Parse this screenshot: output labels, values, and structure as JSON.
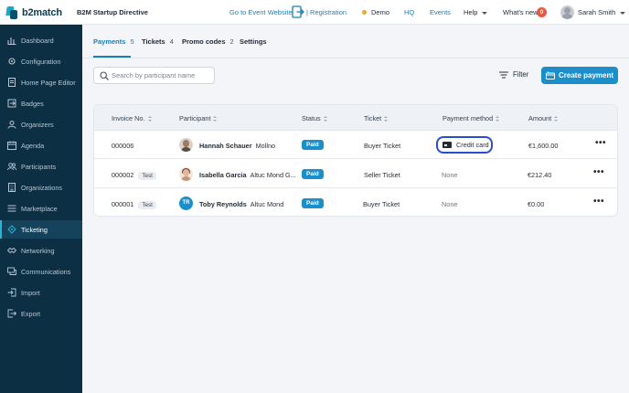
{
  "header": {
    "logo_text": "b2match",
    "event_title": "B2M Startup Directive",
    "go_to_event_website": "Go to Event Website",
    "registration": "| Registration",
    "demo": "Demo",
    "hq": "HQ",
    "events": "Events",
    "help": "Help",
    "whats_new": "What's new",
    "whats_new_count": "0",
    "user_name": "Sarah Smith"
  },
  "sidebar": {
    "items": [
      {
        "label": "Dashboard",
        "icon": "dashboard-icon"
      },
      {
        "label": "Configuration",
        "icon": "gear-icon"
      },
      {
        "label": "Home Page Editor",
        "icon": "document-icon"
      },
      {
        "label": "Badges",
        "icon": "badge-icon"
      },
      {
        "label": "Organizers",
        "icon": "organizers-icon"
      },
      {
        "label": "Agenda",
        "icon": "calendar-icon"
      },
      {
        "label": "Participants",
        "icon": "participants-icon"
      },
      {
        "label": "Organizations",
        "icon": "building-icon"
      },
      {
        "label": "Marketplace",
        "icon": "marketplace-icon"
      },
      {
        "label": "Ticketing",
        "icon": "ticket-icon",
        "active": true
      },
      {
        "label": "Networking",
        "icon": "networking-icon"
      },
      {
        "label": "Communications",
        "icon": "chat-icon"
      },
      {
        "label": "Import",
        "icon": "import-icon"
      },
      {
        "label": "Export",
        "icon": "export-icon"
      }
    ]
  },
  "tabs": [
    {
      "label": "Payments",
      "count": "5",
      "active": true
    },
    {
      "label": "Tickets",
      "count": "4"
    },
    {
      "label": "Promo codes",
      "count": "2"
    },
    {
      "label": "Settings",
      "count": ""
    }
  ],
  "toolbar": {
    "search_placeholder": "Search by participant name",
    "filter_label": "Filter",
    "create_label": "Create payment"
  },
  "table": {
    "columns": [
      "Invoice No.",
      "Participant",
      "Status",
      "Ticket",
      "Payment method",
      "Amount"
    ],
    "rows": [
      {
        "invoice": "000006",
        "test": "",
        "participant": "Hannah Schauer",
        "company": "Mollno",
        "avatar": "photo",
        "status": "Paid",
        "ticket": "Buyer Ticket",
        "payment_method": "Credit card",
        "amount": "€1,600.00"
      },
      {
        "invoice": "000002",
        "test": "Test",
        "participant": "Isabella Garcia",
        "company": "Altuc Mond G...",
        "avatar": "photo",
        "status": "Paid",
        "ticket": "Seller Ticket",
        "payment_method": "None",
        "amount": "€212.40"
      },
      {
        "invoice": "000001",
        "test": "Test",
        "participant": "Toby Reynolds",
        "company": "Altuc Mond",
        "avatar": "TR",
        "status": "Paid",
        "ticket": "Buyer Ticket",
        "payment_method": "None",
        "amount": "€0.00"
      }
    ],
    "more_label": "•••"
  },
  "colors": {
    "accent": "#1a8fc9",
    "sidebar_bg": "#0c2f44",
    "highlight_ring": "#2d4bd1"
  }
}
